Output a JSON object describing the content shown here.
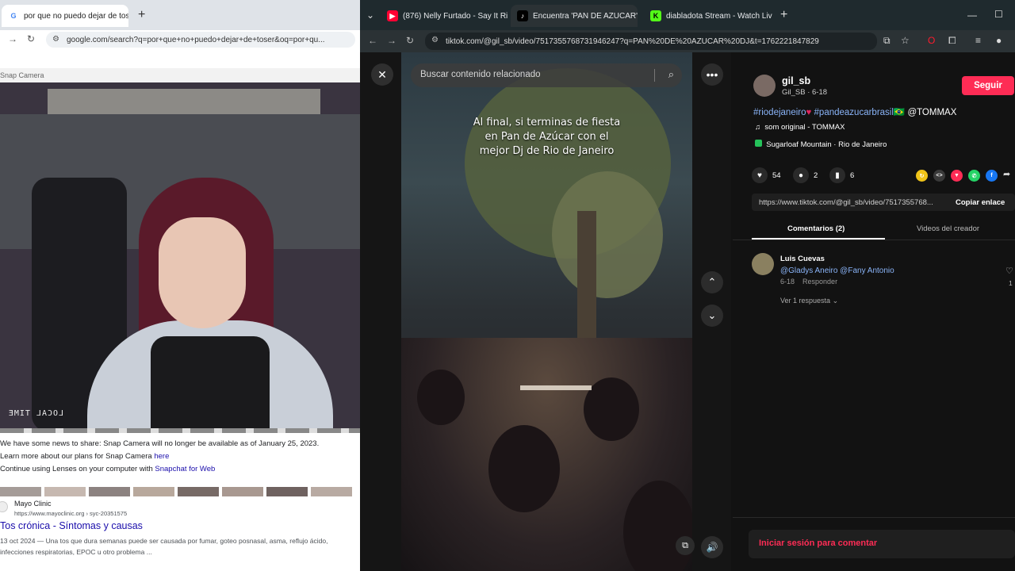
{
  "left_browser": {
    "tab": "por que no puedo dejar de toser",
    "url": "google.com/search?q=por+que+no+puedo+dejar+de+toser&oq=por+qu..."
  },
  "snap_camera": {
    "title": "Snap Camera",
    "overlay": "LOCAL TIME",
    "notice_1": "We have some news to share: Snap Camera will no longer be available as of January 25, 2023.",
    "notice_2_prefix": "Learn more about our plans for Snap Camera",
    "notice_2_link": "here",
    "notice_3_prefix": "Continue using Lenses on your computer with",
    "notice_3_link": "Snapchat for Web"
  },
  "search_result": {
    "site": "Mayo Clinic",
    "url": "https://www.mayoclinic.org › syc-20351575",
    "title": "Tos crónica - Síntomas y causas",
    "snippet": "13 oct 2024 — Una tos que dura semanas puede ser causada por fumar, goteo posnasal, asma, reflujo ácido, infecciones respiratorias, EPOC u otro problema ..."
  },
  "right_browser": {
    "tabs": [
      {
        "label": "(876) Nelly Furtado - Say It Rig"
      },
      {
        "label": "Encuentra 'PAN DE AZUCAR'"
      },
      {
        "label": "diabladota Stream - Watch Live"
      }
    ],
    "url": "tiktok.com/@gil_sb/video/7517355768731946247?q=PAN%20DE%20AZUCAR%20DJ&t=1762221847829"
  },
  "tiktok": {
    "search_placeholder": "Buscar contenido relacionado",
    "caption": "Al final, si terminas de fiesta\nen Pan de Azúcar con el\nmejor Dj de Rio de Janeiro",
    "username": "gil_sb",
    "handle_date": "Gil_SB · 6-18",
    "follow": "Seguir",
    "hashtag_1": "#riodejaneiro",
    "hashtag_2": "#pandeazucarbrasil",
    "hashtag_2_suffix": "🇧🇷",
    "mention": "@TOMMAX",
    "sound": "som original - TOMMAX",
    "location": "Sugarloaf Mountain · Rio de Janeiro",
    "likes": "54",
    "comments": "2",
    "saves": "6",
    "link": "https://www.tiktok.com/@gil_sb/video/7517355768...",
    "copy_link": "Copiar enlace",
    "tab_comments": "Comentarios (2)",
    "tab_videos": "Videos del creador",
    "comment": {
      "author": "Luis Cuevas",
      "text": "@Gladys Aneiro @Fany Antonio",
      "date": "6-18",
      "reply": "Responder",
      "replies": "Ver 1 respuesta",
      "like_count": "1"
    },
    "login_prompt": "Iniciar sesión para comentar"
  },
  "colors": {
    "accent": "#fe2c55",
    "link": "#8ab4f8"
  }
}
